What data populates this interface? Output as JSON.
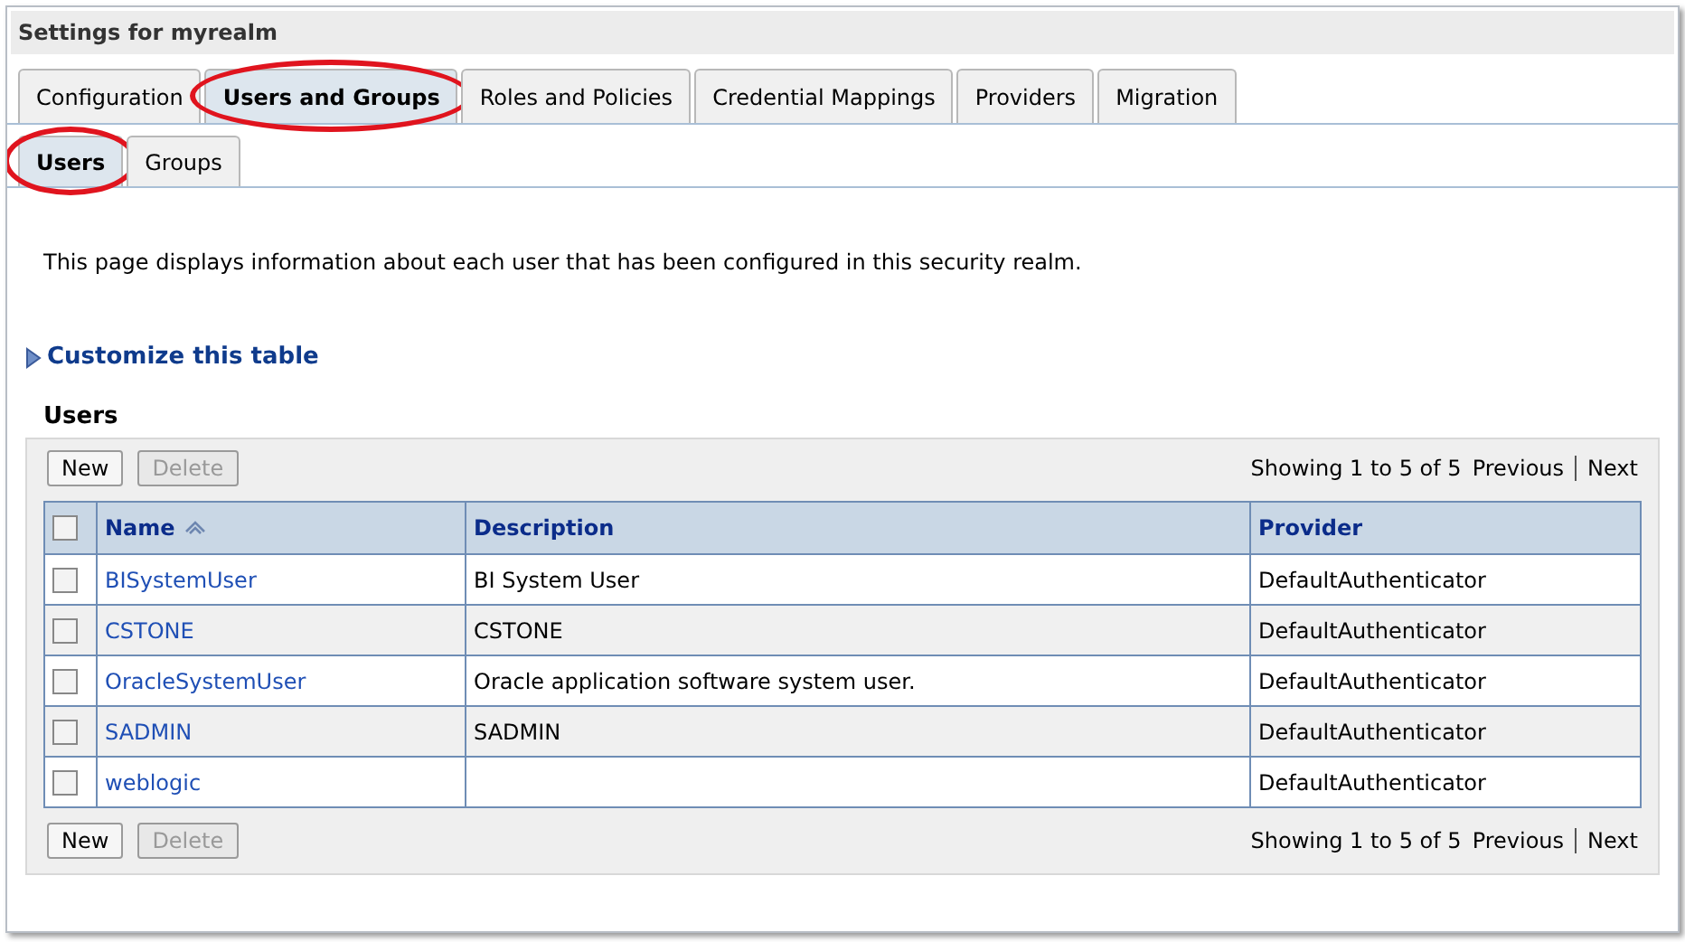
{
  "title": "Settings for myrealm",
  "tabs": [
    {
      "label": "Configuration",
      "selected": false,
      "highlighted": false
    },
    {
      "label": "Users and Groups",
      "selected": true,
      "highlighted": true
    },
    {
      "label": "Roles and Policies",
      "selected": false,
      "highlighted": false
    },
    {
      "label": "Credential Mappings",
      "selected": false,
      "highlighted": false
    },
    {
      "label": "Providers",
      "selected": false,
      "highlighted": false
    },
    {
      "label": "Migration",
      "selected": false,
      "highlighted": false
    }
  ],
  "subtabs": [
    {
      "label": "Users",
      "selected": true,
      "highlighted": true
    },
    {
      "label": "Groups",
      "selected": false,
      "highlighted": false
    }
  ],
  "intro": "This page displays information about each user that has been configured in this security realm.",
  "customize_link": "Customize this table",
  "table": {
    "heading": "Users",
    "buttons": [
      {
        "label": "New",
        "disabled": false
      },
      {
        "label": "Delete",
        "disabled": true
      }
    ],
    "pager": {
      "showing": "Showing 1 to 5 of 5",
      "previous": "Previous",
      "next": "Next"
    },
    "select_all": {
      "checked": false
    },
    "columns": [
      "Name",
      "Description",
      "Provider"
    ],
    "rows": [
      {
        "name": "BISystemUser",
        "description": "BI System User",
        "provider": "DefaultAuthenticator",
        "checked": false
      },
      {
        "name": "CSTONE",
        "description": "CSTONE",
        "provider": "DefaultAuthenticator",
        "checked": false
      },
      {
        "name": "OracleSystemUser",
        "description": "Oracle application software system user.",
        "provider": "DefaultAuthenticator",
        "checked": false
      },
      {
        "name": "SADMIN",
        "description": "SADMIN",
        "provider": "DefaultAuthenticator",
        "checked": false
      },
      {
        "name": "weblogic",
        "description": "",
        "provider": "DefaultAuthenticator",
        "checked": false
      }
    ],
    "bottom_buttons": [
      {
        "label": "New",
        "disabled": false
      },
      {
        "label": "Delete",
        "disabled": true
      }
    ],
    "bottom_pager": {
      "showing": "Showing 1 to 5 of 5",
      "previous": "Previous",
      "next": "Next"
    }
  }
}
